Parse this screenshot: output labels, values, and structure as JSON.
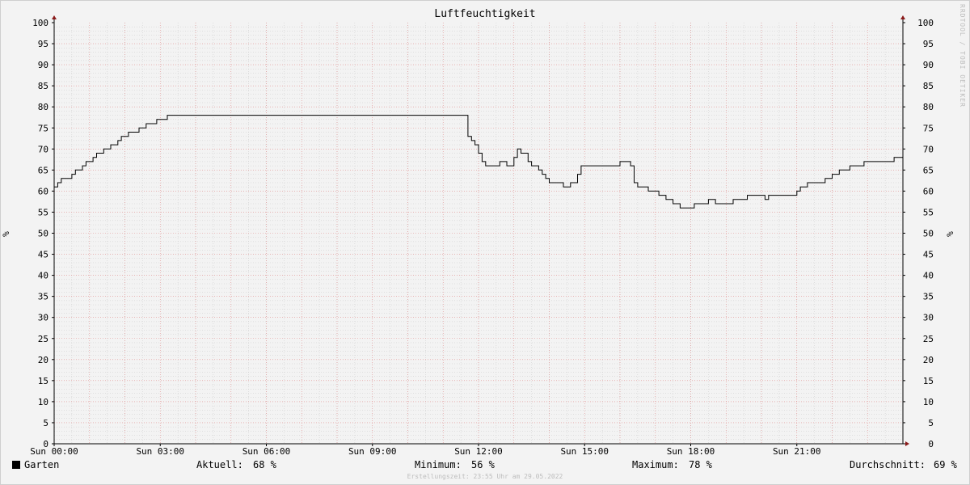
{
  "title": "Luftfeuchtigkeit",
  "ylabel_left": "%",
  "ylabel_right": "%",
  "side_note": "RRDTOOL / TOBI OETIKER",
  "footer": "Erstellungszeit: 23:55 Uhr am 29.05.2022",
  "colors": {
    "line": "#000000",
    "major_grid": "#e08a8a",
    "minor_grid": "#c8c8c8",
    "axis": "#000000",
    "arrow": "#8b1a1a"
  },
  "legend": {
    "series": "Garten",
    "current_label": "Aktuell:",
    "current_value": "68 %",
    "min_label": "Minimum:",
    "min_value": "56 %",
    "max_label": "Maximum:",
    "max_value": "78 %",
    "avg_label": "Durchschnitt:",
    "avg_value": "69 %"
  },
  "chart_data": {
    "type": "line",
    "title": "Luftfeuchtigkeit",
    "xlabel": "",
    "ylabel": "%",
    "ylim": [
      0,
      100
    ],
    "xlim_hours": [
      0,
      24
    ],
    "yticks": [
      0,
      5,
      10,
      15,
      20,
      25,
      30,
      35,
      40,
      45,
      50,
      55,
      60,
      65,
      70,
      75,
      80,
      85,
      90,
      95,
      100
    ],
    "xticks": [
      {
        "hour": 0,
        "label": "Sun 00:00"
      },
      {
        "hour": 3,
        "label": "Sun 03:00"
      },
      {
        "hour": 6,
        "label": "Sun 06:00"
      },
      {
        "hour": 9,
        "label": "Sun 09:00"
      },
      {
        "hour": 12,
        "label": "Sun 12:00"
      },
      {
        "hour": 15,
        "label": "Sun 15:00"
      },
      {
        "hour": 18,
        "label": "Sun 18:00"
      },
      {
        "hour": 21,
        "label": "Sun 21:00"
      }
    ],
    "grid": true,
    "series": [
      {
        "name": "Garten",
        "x_hours": [
          0.0,
          0.1,
          0.2,
          0.4,
          0.5,
          0.6,
          0.8,
          0.9,
          1.1,
          1.2,
          1.4,
          1.6,
          1.8,
          1.9,
          2.1,
          2.4,
          2.6,
          2.9,
          3.2,
          3.5,
          3.6,
          3.7,
          3.8,
          3.9,
          4.1,
          4.2,
          11.6,
          11.7,
          11.8,
          11.9,
          12.0,
          12.1,
          12.2,
          12.3,
          12.6,
          12.7,
          12.8,
          13.0,
          13.1,
          13.2,
          13.4,
          13.5,
          13.7,
          13.8,
          13.9,
          14.0,
          14.2,
          14.4,
          14.6,
          14.8,
          14.9,
          15.1,
          15.2,
          15.3,
          15.4,
          16.0,
          16.3,
          16.4,
          16.5,
          16.8,
          16.9,
          17.1,
          17.3,
          17.5,
          17.7,
          17.9,
          18.1,
          18.5,
          18.7,
          18.9,
          19.2,
          19.3,
          19.6,
          19.8,
          20.1,
          20.2,
          20.4,
          21.0,
          21.1,
          21.3,
          21.5,
          21.8,
          22.0,
          22.2,
          22.5,
          22.9,
          23.5,
          23.75,
          23.9
        ],
        "y": [
          61,
          62,
          63,
          63,
          64,
          65,
          66,
          67,
          68,
          69,
          70,
          71,
          72,
          73,
          74,
          75,
          76,
          77,
          78,
          78,
          78,
          78,
          78,
          78,
          78,
          78,
          78,
          73,
          72,
          71,
          69,
          67,
          66,
          66,
          67,
          67,
          66,
          68,
          70,
          69,
          67,
          66,
          65,
          64,
          63,
          62,
          62,
          61,
          62,
          64,
          66,
          66,
          66,
          66,
          66,
          67,
          66,
          62,
          61,
          60,
          60,
          59,
          58,
          57,
          56,
          56,
          57,
          58,
          57,
          57,
          58,
          58,
          59,
          59,
          58,
          59,
          59,
          60,
          61,
          62,
          62,
          63,
          64,
          65,
          66,
          67,
          67,
          68,
          68
        ]
      }
    ]
  }
}
